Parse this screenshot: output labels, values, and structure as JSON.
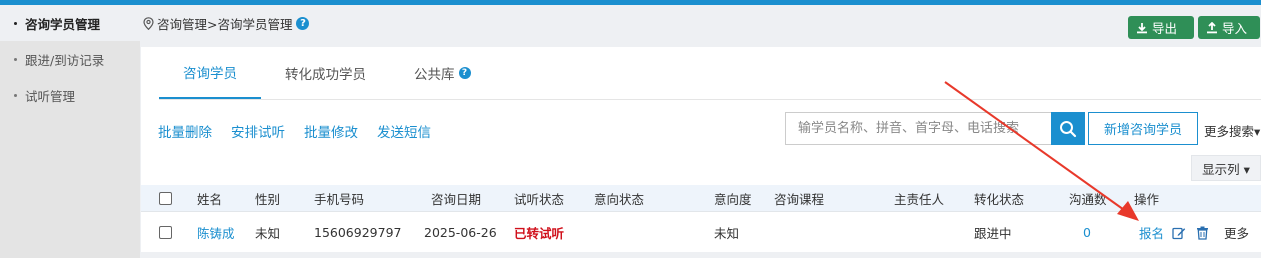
{
  "sidebar": {
    "items": [
      {
        "label": "咨询学员管理",
        "active": true
      },
      {
        "label": "跟进/到访记录",
        "active": false
      },
      {
        "label": "试听管理",
        "active": false
      }
    ]
  },
  "breadcrumb": {
    "text": "咨询管理>咨询学员管理",
    "help": "?"
  },
  "header_buttons": {
    "export_label": "导出",
    "import_label": "导入"
  },
  "tabs": [
    {
      "label": "咨询学员",
      "active": true
    },
    {
      "label": "转化成功学员",
      "active": false
    },
    {
      "label": "公共库",
      "active": false,
      "help": "?"
    }
  ],
  "actions": {
    "batch_delete": "批量删除",
    "schedule_trial": "安排试听",
    "batch_edit": "批量修改",
    "send_sms": "发送短信"
  },
  "search": {
    "placeholder": "输学员名称、拼音、首字母、电话搜索",
    "add_button": "新增咨询学员",
    "more_search": "更多搜索▾"
  },
  "show_columns": "显示列 ▾",
  "table": {
    "headers": {
      "name": "姓名",
      "gender": "性别",
      "phone": "手机号码",
      "date": "咨询日期",
      "trial_status": "试听状态",
      "intent_status": "意向状态",
      "intent_level": "意向度",
      "course": "咨询课程",
      "owner": "主责任人",
      "convert_status": "转化状态",
      "contacts": "沟通数",
      "ops": "操作"
    },
    "rows": [
      {
        "name": "陈铸成",
        "gender": "未知",
        "phone": "15606929797",
        "date": "2025-06-26",
        "trial_status": "已转试听",
        "intent_status": "",
        "intent_level": "未知",
        "course": "",
        "owner": "",
        "convert_status": "跟进中",
        "contacts": "0",
        "ops": {
          "enroll": "报名",
          "more": "更多"
        }
      }
    ]
  },
  "colors": {
    "accent": "#1b8fcf",
    "green_button": "#2f8f57",
    "status_red": "#d0101b",
    "annotation_arrow": "#e8392b"
  }
}
